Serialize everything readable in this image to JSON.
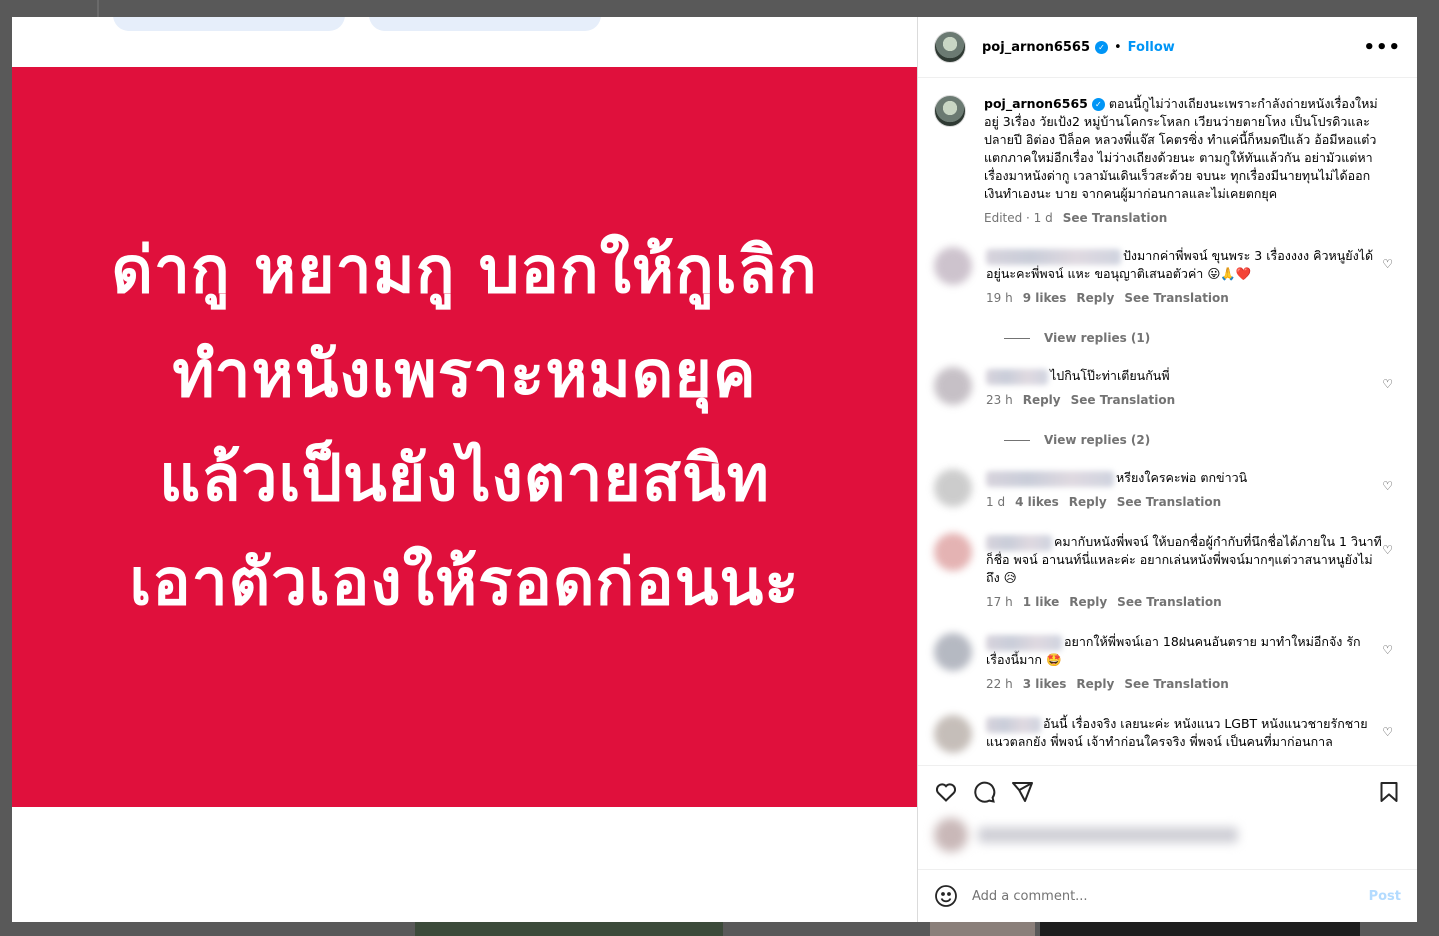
{
  "post": {
    "username": "poj_arnon6565",
    "follow_label": "Follow",
    "more_label": "•••",
    "dot": "•",
    "verified_glyph": "✓"
  },
  "media": {
    "background": "#e0103c",
    "lines": [
      "ด่ากู หยามกู บอกให้กูเลิก",
      "ทำหนังเพราะหมดยุค",
      "แล้วเป็นยังไงตายสนิท",
      "เอาตัวเองให้รอดก่อนนะ"
    ]
  },
  "caption": {
    "username": "poj_arnon6565",
    "text": "ตอนนี้กูไม่ว่างเถียงนะเพราะกำลังถ่ายหนังเรื่องใหม่อยู่ 3เรื่อง วัยเป้ง2 หมู่บ้านโคกระโหลก เวียนว่ายตายโหง เป็นโปรดิวและปลายปี อิต่อง ปีล็อค หลวงพี่แจ๊ส โคตรซิ่ง ทำแค่นี้ก็หมดปีแล้ว อ้อมีหอแต๋วแตกภาคใหม่อีกเรื่อง ไม่ว่างเถียงด้วยนะ ตามกูให้ทันแล้วกัน อย่ามัวแต่หาเรื่องมาหนังด่ากู เวลามันเดินเร็วสะด้วย จบนะ ทุกเรื่องมีนายทุนไม่ได้ออกเงินทำเองนะ บาย จากคนผู้มาก่อนกาลและไม่เคยตกยุค",
    "edited": "Edited · 1 d",
    "see_translation": "See Translation"
  },
  "comments": [
    {
      "text": "ปังมากค่าพี่พจน์ ขุนพระ 3 เรื่องงงง คิวหนูยังได้อยู่นะคะพี่พจน์ แหะ ขอนุญาติเสนอตัวค่า",
      "emojis": "😛🙏❤️",
      "time": "19 h",
      "likes": "9 likes",
      "reply": "Reply",
      "see_translation": "See Translation",
      "view_replies": "View replies (1)"
    },
    {
      "text": "ไปกินโป๊ะท่าเตียนกันพี่",
      "emojis": "",
      "time": "23 h",
      "likes": "",
      "reply": "Reply",
      "see_translation": "See Translation",
      "view_replies": "View replies (2)"
    },
    {
      "text": "หรียงใครคะพ่อ ตกข่าวนิ",
      "emojis": "",
      "time": "1 d",
      "likes": "4 likes",
      "reply": "Reply",
      "see_translation": "See Translation",
      "view_replies": ""
    },
    {
      "text": "คมากับหนังพี่พจน์ ให้บอกชื่อผู้กำกับที่นึกชื่อได้ภายใน 1 วินาที ก็ชื่อ พจน์ อานนท์นี่แหละค่ะ อยากเล่นหนังพี่พจน์มากๆแต่วาสนาหนูยังไม่ถึง",
      "emojis": "😥",
      "time": "17 h",
      "likes": "1 like",
      "reply": "Reply",
      "see_translation": "See Translation",
      "view_replies": ""
    },
    {
      "text": "อยากให้พี่พจน์เอา 18ฝนคนอันตราย มาทำใหม่อีกจัง รักเรื่องนี้มาก",
      "emojis": "🤩",
      "time": "22 h",
      "likes": "3 likes",
      "reply": "Reply",
      "see_translation": "See Translation",
      "view_replies": ""
    },
    {
      "text": "อันนี้ เรื่องจริง เลยนะค่ะ หนังแนว LGBT หนังแนวชายรักชาย แนวตลกยัง พี่พจน์ เจ้าทำก่อนใครจริง พี่พจน์ เป็นคนที่มาก่อนกาล",
      "emojis": "",
      "time": "",
      "likes": "",
      "reply": "",
      "see_translation": "",
      "view_replies": ""
    }
  ],
  "actions": {
    "like_icon": "heart-icon",
    "comment_icon": "comment-icon",
    "share_icon": "share-icon",
    "save_icon": "bookmark-icon"
  },
  "composer": {
    "placeholder": "Add a comment...",
    "post_label": "Post"
  }
}
